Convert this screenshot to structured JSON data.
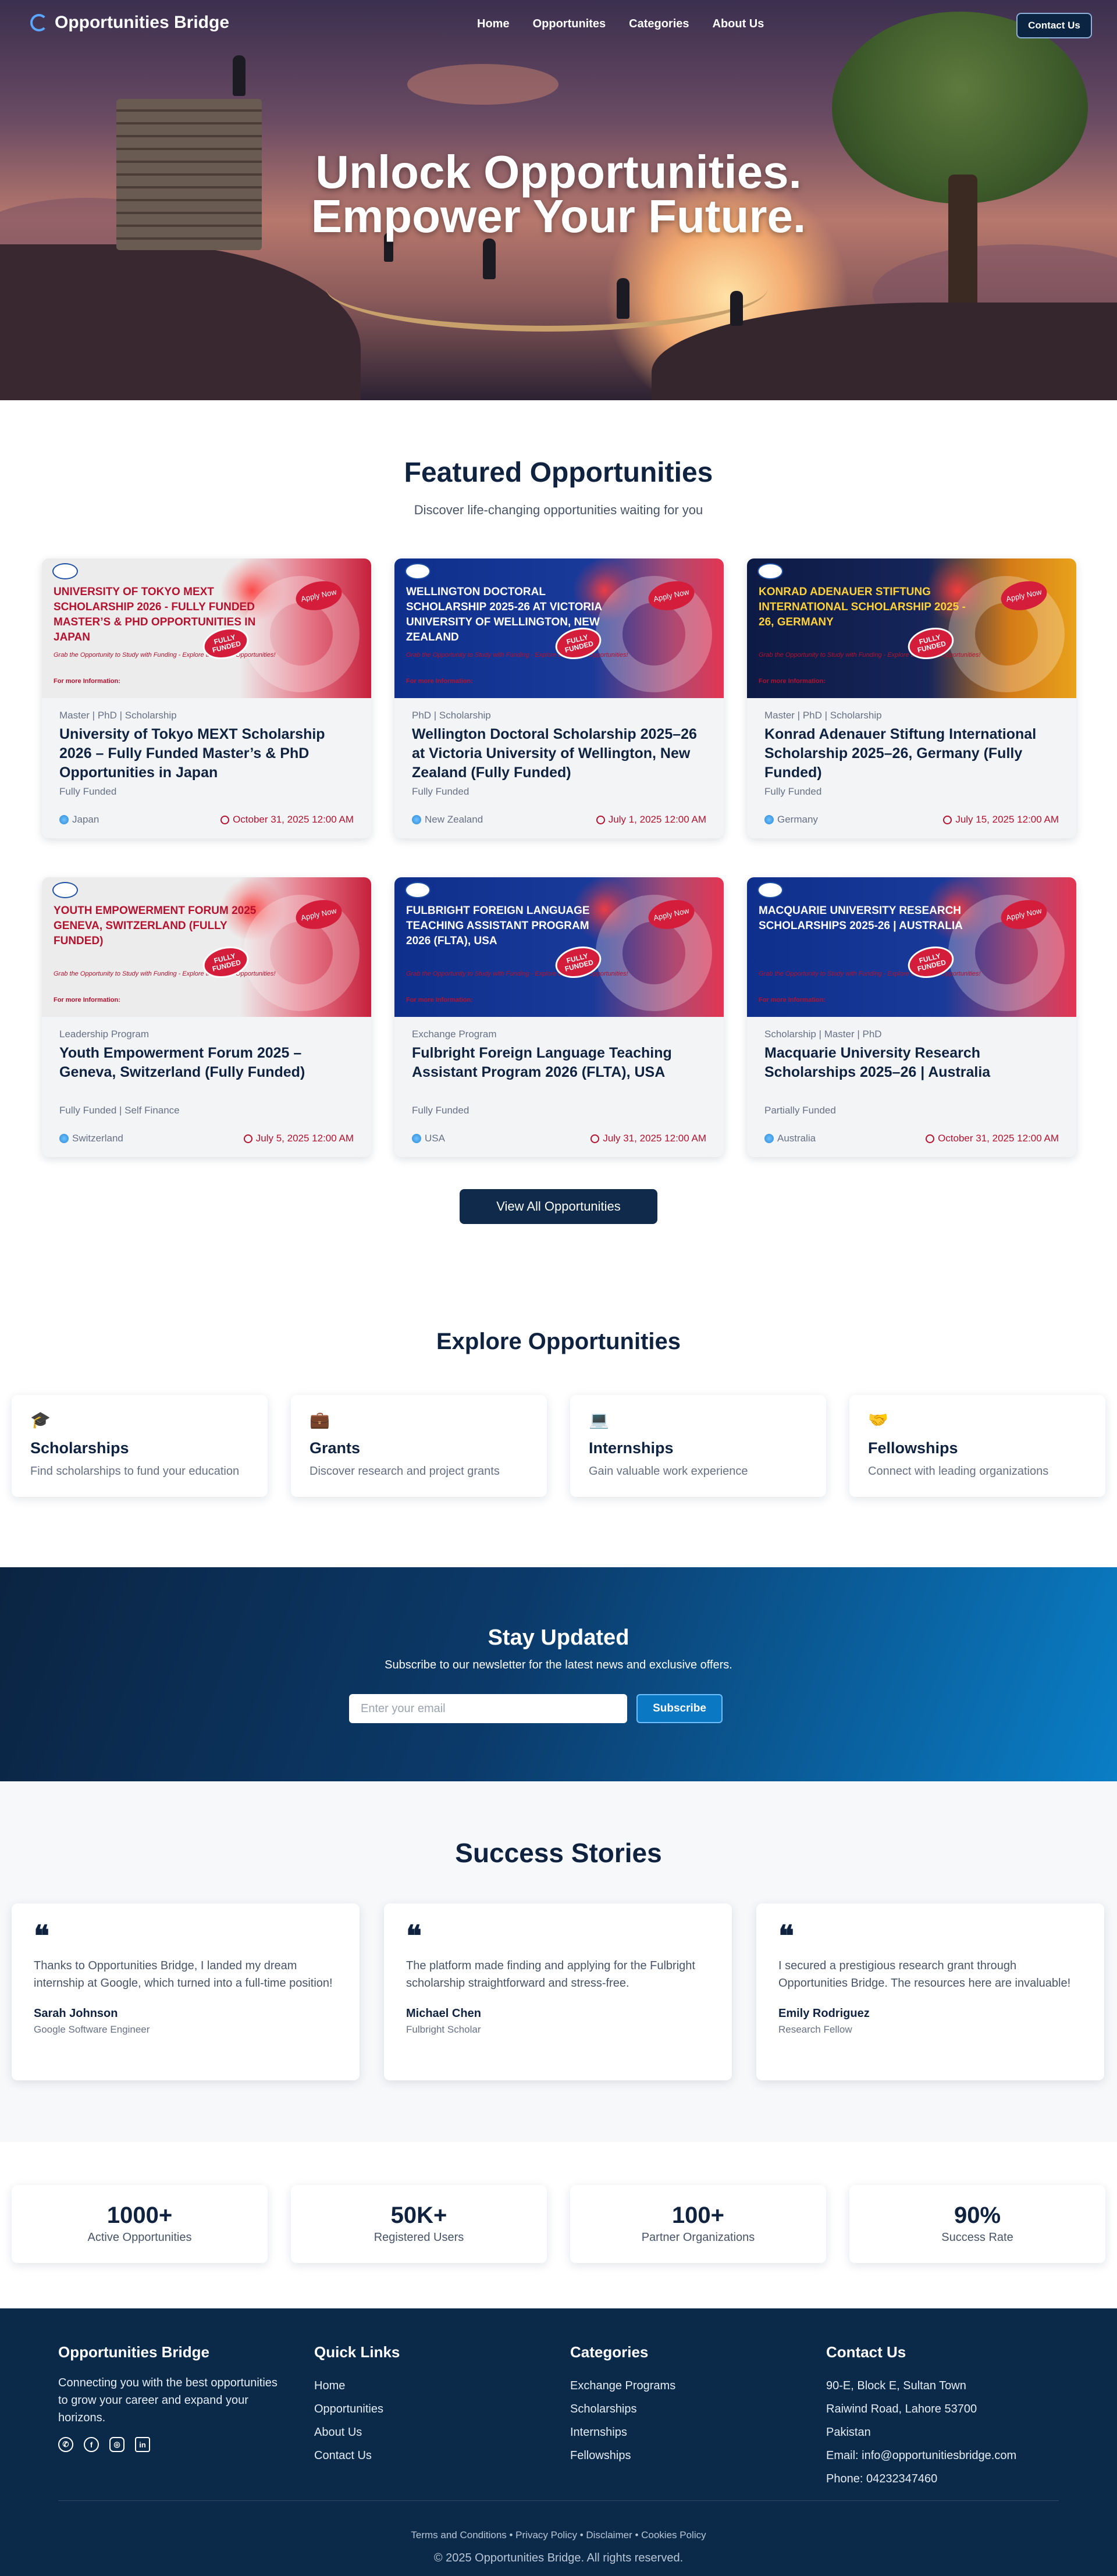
{
  "brand": {
    "name": "Opportunities Bridge"
  },
  "nav": {
    "links": [
      "Home",
      "Opportunites",
      "Categories",
      "About Us"
    ],
    "contact_label": "Contact Us"
  },
  "hero": {
    "line1": "Unlock Opportunities.",
    "line2": "Empower Your Future."
  },
  "featured": {
    "title": "Featured Opportunities",
    "subtitle": "Discover life-changing opportunities waiting for you",
    "cards": [
      {
        "image_title": "University of Tokyo MEXT Scholarship 2026 - Fully Funded Master’s & PhD Opportunities in Japan",
        "image_theme": "light",
        "tags": "Master | PhD | Scholarship",
        "title": "University of Tokyo MEXT Scholarship 2026 – Fully Funded Master’s & PhD Opportunities in Japan",
        "funding": "Fully Funded",
        "country": "Japan",
        "deadline": "October 31, 2025 12:00 AM"
      },
      {
        "image_title": "Wellington Doctoral Scholarship 2025-26 at Victoria University of Wellington, New Zealand",
        "image_theme": "blue",
        "tags": "PhD | Scholarship",
        "title": "Wellington Doctoral Scholarship 2025–26 at Victoria University of Wellington, New Zealand (Fully Funded)",
        "funding": "Fully Funded",
        "country": "New Zealand",
        "deadline": "July 1, 2025 12:00 AM"
      },
      {
        "image_title": "Konrad Adenauer Stiftung International Scholarship 2025 - 26, Germany",
        "image_theme": "dark",
        "tags": "Master | PhD | Scholarship",
        "title": "Konrad Adenauer Stiftung International Scholarship 2025–26, Germany (Fully Funded)",
        "funding": "Fully Funded",
        "country": "Germany",
        "deadline": "July 15, 2025 12:00 AM"
      },
      {
        "image_title": "Youth Empowerment Forum 2025 Geneva, Switzerland (Fully Funded)",
        "image_theme": "light",
        "tags": "Leadership Program",
        "title": "Youth Empowerment Forum 2025 – Geneva, Switzerland (Fully Funded)",
        "funding": "Fully Funded | Self Finance",
        "country": "Switzerland",
        "deadline": "July 5, 2025 12:00 AM"
      },
      {
        "image_title": "Fulbright Foreign Language Teaching Assistant Program 2026 (FLTA), USA",
        "image_theme": "blue",
        "tags": "Exchange Program",
        "title": "Fulbright Foreign Language Teaching Assistant Program 2026 (FLTA), USA",
        "funding": "Fully Funded",
        "country": "USA",
        "deadline": "July 31, 2025 12:00 AM"
      },
      {
        "image_title": "Macquarie University Research Scholarships 2025-26 | Australia",
        "image_theme": "blue",
        "tags": "Scholarship | Master | PhD",
        "title": "Macquarie University Research Scholarships 2025–26 | Australia",
        "funding": "Partially Funded",
        "country": "Australia",
        "deadline": "October 31, 2025 12:00 AM"
      }
    ],
    "card_image": {
      "apply_text": "Apply Now",
      "funded_text": "FULLY FUNDED",
      "tagline": "Grab the Opportunity to Study with Funding - Explore the Latest Opportunities!",
      "more_info": "For more Information:"
    },
    "view_all_label": "View All Opportunities"
  },
  "explore": {
    "title": "Explore Opportunities",
    "items": [
      {
        "icon": "graduation-cap-icon",
        "title": "Scholarships",
        "desc": "Find scholarships to fund your education"
      },
      {
        "icon": "briefcase-icon",
        "title": "Grants",
        "desc": "Discover research and project grants"
      },
      {
        "icon": "laptop-icon",
        "title": "Internships",
        "desc": "Gain valuable work experience"
      },
      {
        "icon": "handshake-icon",
        "title": "Fellowships",
        "desc": "Connect with leading organizations"
      }
    ]
  },
  "newsletter": {
    "title": "Stay Updated",
    "subtitle": "Subscribe to our newsletter for the latest news and exclusive offers.",
    "placeholder": "Enter your email",
    "button": "Subscribe"
  },
  "stories": {
    "title": "Success Stories",
    "items": [
      {
        "text": "Thanks to Opportunities Bridge, I landed my dream internship at Google, which turned into a full-time position!",
        "name": "Sarah Johnson",
        "role": "Google Software Engineer"
      },
      {
        "text": "The platform made finding and applying for the Fulbright scholarship straightforward and stress-free.",
        "name": "Michael Chen",
        "role": "Fulbright Scholar"
      },
      {
        "text": "I secured a prestigious research grant through Opportunities Bridge. The resources here are invaluable!",
        "name": "Emily Rodriguez",
        "role": "Research Fellow"
      }
    ]
  },
  "stats": [
    {
      "value": "1000+",
      "label": "Active Opportunities"
    },
    {
      "value": "50K+",
      "label": "Registered Users"
    },
    {
      "value": "100+",
      "label": "Partner Organizations"
    },
    {
      "value": "90%",
      "label": "Success Rate"
    }
  ],
  "footer": {
    "about_title": "Opportunities Bridge",
    "about_text": "Connecting you with the best opportunities to grow your career and expand your horizons.",
    "quick_title": "Quick Links",
    "quick_links": [
      "Home",
      "Opportunities",
      "About Us",
      "Contact Us"
    ],
    "cat_title": "Categories",
    "categories": [
      "Exchange Programs",
      "Scholarships",
      "Internships",
      "Fellowships"
    ],
    "contact_title": "Contact Us",
    "contact_lines": [
      "90-E, Block E, Sultan Town",
      "Raiwind Road, Lahore 53700",
      "Pakistan",
      "Email: info@opportunitiesbridge.com",
      "Phone: 04232347460"
    ],
    "legal": "Terms and Conditions • Privacy Policy • Disclaimer • Cookies Policy",
    "copyright": "© 2025 Opportunities Bridge. All rights reserved."
  },
  "colors": {
    "navy": "#0f2340",
    "accent_red": "#b4122e",
    "footer_bg": "#0b2a4a",
    "newsletter_end": "#0a7ec6"
  }
}
